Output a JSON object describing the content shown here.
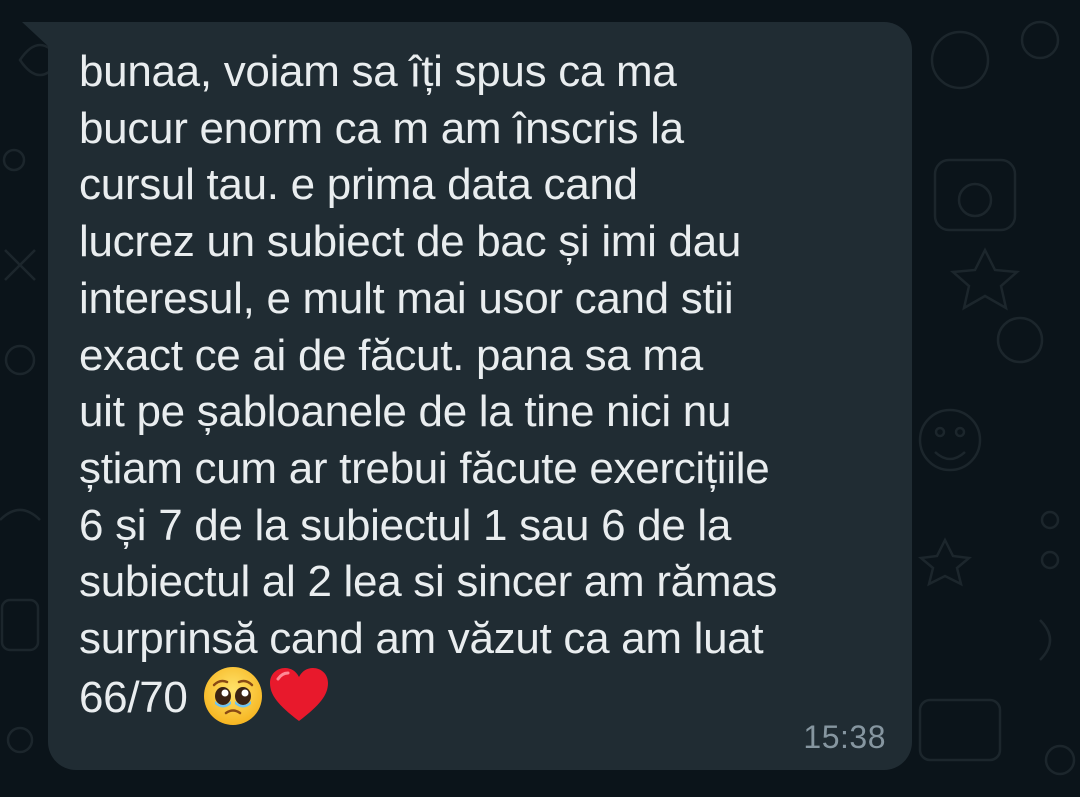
{
  "colors": {
    "background": "#0b141a",
    "bubble": "#202c33",
    "text": "#e9edef",
    "timestamp": "#8696a0"
  },
  "message": {
    "lines": [
      "bunaa, voiam sa îți spus ca ma",
      "bucur enorm ca m am înscris la",
      "cursul tau. e prima data cand",
      "lucrez un subiect de bac și imi dau",
      "interesul, e mult mai usor cand stii",
      "exact ce ai de făcut. pana sa ma",
      "uit pe șabloanele de la tine nici nu",
      "știam cum ar trebui făcute exercițiile",
      "6 și 7 de la subiectul 1 sau 6 de la",
      "subiectul al 2 lea si sincer am rămas",
      "surprinsă cand am văzut ca am luat",
      "66/70"
    ],
    "emojis": [
      "pleading-face-icon",
      "red-heart-icon"
    ],
    "time": "15:38"
  }
}
